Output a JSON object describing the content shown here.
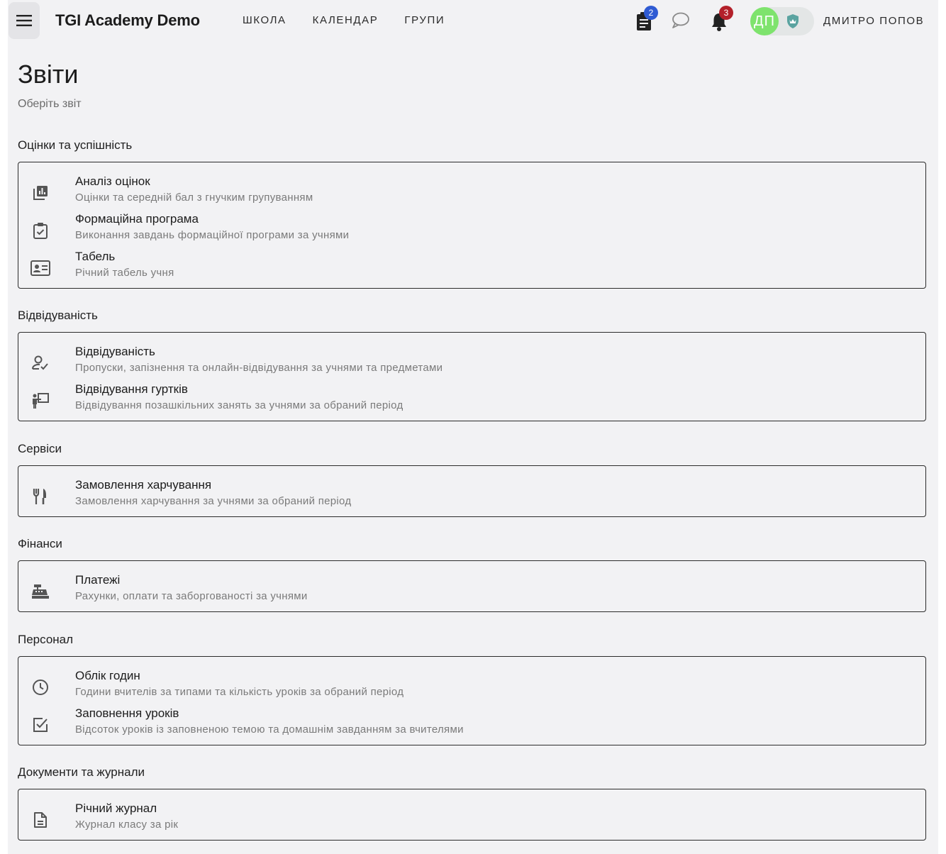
{
  "header": {
    "brand": "TGI Academy Demo",
    "nav": [
      "ШКОЛА",
      "КАЛЕНДАР",
      "ГРУПИ"
    ],
    "tasks_badge": "2",
    "notifications_badge": "3",
    "avatar_initials": "ДП",
    "user_name": "ДМИТРО ПОПОВ",
    "colors": {
      "avatar": "#7ee36d",
      "tasks_badge": "#2f5bd3",
      "notifications_badge": "#b3202a",
      "role_icon": "#5aa3a0"
    }
  },
  "page": {
    "title": "Звіти",
    "subtitle": "Оберіть звіт"
  },
  "sections": [
    {
      "title": "Оцінки та успішність",
      "items": [
        {
          "icon": "chart-library-icon",
          "title": "Аналіз оцінок",
          "desc": "Оцінки та середній бал з гнучким групуванням"
        },
        {
          "icon": "clipboard-check-icon",
          "title": "Формаційна програма",
          "desc": "Виконання завдань формаційної програми за учнями"
        },
        {
          "icon": "id-card-icon",
          "title": "Табель",
          "desc": "Річний табель учня"
        }
      ]
    },
    {
      "title": "Відвідуваність",
      "items": [
        {
          "icon": "person-check-icon",
          "title": "Відвідуваність",
          "desc": "Пропуски, запізнення та онлайн-відвідування за учнями та предметами"
        },
        {
          "icon": "presenter-icon",
          "title": "Відвідування гуртків",
          "desc": "Відвідування позашкільних занять за учнями за обраний період"
        }
      ]
    },
    {
      "title": "Сервіси",
      "items": [
        {
          "icon": "restaurant-icon",
          "title": "Замовлення харчування",
          "desc": "Замовлення харчування за учнями за обраний період"
        }
      ]
    },
    {
      "title": "Фінанси",
      "items": [
        {
          "icon": "cash-register-icon",
          "title": "Платежі",
          "desc": "Рахунки, оплати та заборгованості за учнями"
        }
      ]
    },
    {
      "title": "Персонал",
      "items": [
        {
          "icon": "clock-icon",
          "title": "Облік годин",
          "desc": "Години вчителів за типами та кількість уроків за обраний період"
        },
        {
          "icon": "checkbox-icon",
          "title": "Заповнення уроків",
          "desc": "Відсоток уроків із заповненою темою та домашнім завданням за вчителями"
        }
      ]
    },
    {
      "title": "Документи та журнали",
      "items": [
        {
          "icon": "document-icon",
          "title": "Річний журнал",
          "desc": "Журнал класу за рік"
        }
      ]
    }
  ]
}
